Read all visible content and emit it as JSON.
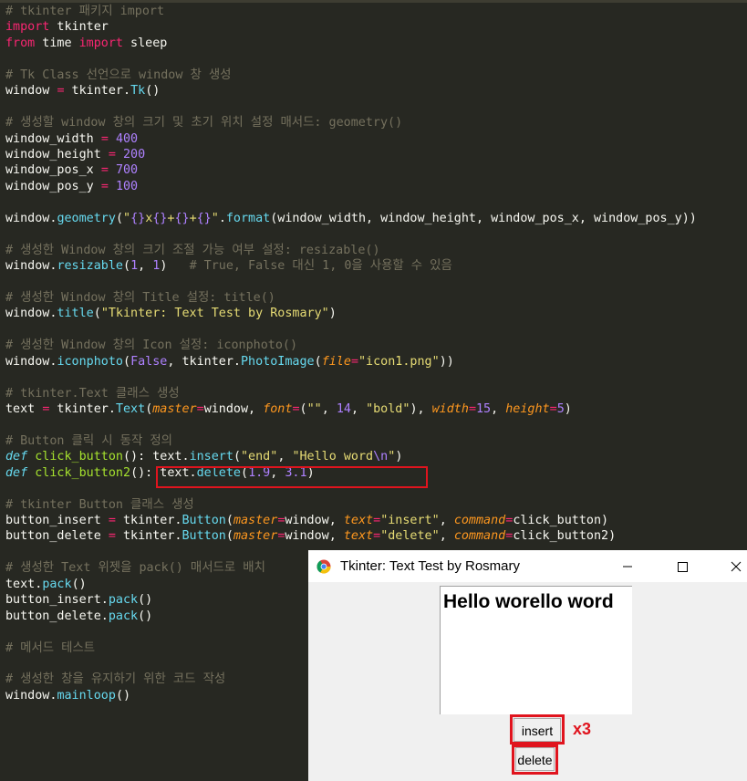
{
  "editor": {
    "lines": [
      [
        {
          "t": "# tkinter 패키지 import",
          "c": "c"
        }
      ],
      [
        {
          "t": "import",
          "c": "k"
        },
        {
          "t": " tkinter"
        }
      ],
      [
        {
          "t": "from",
          "c": "k"
        },
        {
          "t": " time "
        },
        {
          "t": "import",
          "c": "k"
        },
        {
          "t": " sleep"
        }
      ],
      [],
      [
        {
          "t": "# Tk Class 선언으로 window 창 생성",
          "c": "c"
        }
      ],
      [
        {
          "t": "window "
        },
        {
          "t": "=",
          "c": "o"
        },
        {
          "t": " tkinter."
        },
        {
          "t": "Tk",
          "c": "f"
        },
        {
          "t": "()"
        }
      ],
      [],
      [
        {
          "t": "# 생성할 window 창의 크기 및 초기 위치 설정 매서드: geometry()",
          "c": "c"
        }
      ],
      [
        {
          "t": "window_width "
        },
        {
          "t": "=",
          "c": "o"
        },
        {
          "t": " "
        },
        {
          "t": "400",
          "c": "n"
        }
      ],
      [
        {
          "t": "window_height "
        },
        {
          "t": "=",
          "c": "o"
        },
        {
          "t": " "
        },
        {
          "t": "200",
          "c": "n"
        }
      ],
      [
        {
          "t": "window_pos_x "
        },
        {
          "t": "=",
          "c": "o"
        },
        {
          "t": " "
        },
        {
          "t": "700",
          "c": "n"
        }
      ],
      [
        {
          "t": "window_pos_y "
        },
        {
          "t": "=",
          "c": "o"
        },
        {
          "t": " "
        },
        {
          "t": "100",
          "c": "n"
        }
      ],
      [],
      [
        {
          "t": "window."
        },
        {
          "t": "geometry",
          "c": "f"
        },
        {
          "t": "("
        },
        {
          "t": "\"",
          "c": "s"
        },
        {
          "t": "{}",
          "c": "e"
        },
        {
          "t": "x",
          "c": "s"
        },
        {
          "t": "{}",
          "c": "e"
        },
        {
          "t": "+",
          "c": "s"
        },
        {
          "t": "{}",
          "c": "e"
        },
        {
          "t": "+",
          "c": "s"
        },
        {
          "t": "{}",
          "c": "e"
        },
        {
          "t": "\"",
          "c": "s"
        },
        {
          "t": "."
        },
        {
          "t": "format",
          "c": "f"
        },
        {
          "t": "(window_width, window_height, window_pos_x, window_pos_y))"
        }
      ],
      [],
      [
        {
          "t": "# 생성한 Window 창의 크기 조절 가능 여부 설정: resizable()",
          "c": "c"
        }
      ],
      [
        {
          "t": "window."
        },
        {
          "t": "resizable",
          "c": "f"
        },
        {
          "t": "("
        },
        {
          "t": "1",
          "c": "n"
        },
        {
          "t": ", "
        },
        {
          "t": "1",
          "c": "n"
        },
        {
          "t": ")   "
        },
        {
          "t": "# True, False 대신 1, 0을 사용할 수 있음",
          "c": "c"
        }
      ],
      [],
      [
        {
          "t": "# 생성한 Window 창의 Title 설정: title()",
          "c": "c"
        }
      ],
      [
        {
          "t": "window."
        },
        {
          "t": "title",
          "c": "f"
        },
        {
          "t": "("
        },
        {
          "t": "\"Tkinter: Text Test by Rosmary\"",
          "c": "s"
        },
        {
          "t": ")"
        }
      ],
      [],
      [
        {
          "t": "# 생성한 Window 창의 Icon 설정: iconphoto()",
          "c": "c"
        }
      ],
      [
        {
          "t": "window."
        },
        {
          "t": "iconphoto",
          "c": "f"
        },
        {
          "t": "("
        },
        {
          "t": "False",
          "c": "n"
        },
        {
          "t": ", tkinter."
        },
        {
          "t": "PhotoImage",
          "c": "f"
        },
        {
          "t": "("
        },
        {
          "t": "file",
          "c": "a"
        },
        {
          "t": "=",
          "c": "o"
        },
        {
          "t": "\"icon1.png\"",
          "c": "s"
        },
        {
          "t": "))"
        }
      ],
      [],
      [
        {
          "t": "# tkinter.Text 클래스 생성",
          "c": "c"
        }
      ],
      [
        {
          "t": "text "
        },
        {
          "t": "=",
          "c": "o"
        },
        {
          "t": " tkinter."
        },
        {
          "t": "Text",
          "c": "f"
        },
        {
          "t": "("
        },
        {
          "t": "master",
          "c": "a"
        },
        {
          "t": "=",
          "c": "o"
        },
        {
          "t": "window, "
        },
        {
          "t": "font",
          "c": "a"
        },
        {
          "t": "=",
          "c": "o"
        },
        {
          "t": "("
        },
        {
          "t": "\"\"",
          "c": "s"
        },
        {
          "t": ", "
        },
        {
          "t": "14",
          "c": "n"
        },
        {
          "t": ", "
        },
        {
          "t": "\"bold\"",
          "c": "s"
        },
        {
          "t": "), "
        },
        {
          "t": "width",
          "c": "a"
        },
        {
          "t": "=",
          "c": "o"
        },
        {
          "t": "15",
          "c": "n"
        },
        {
          "t": ", "
        },
        {
          "t": "height",
          "c": "a"
        },
        {
          "t": "=",
          "c": "o"
        },
        {
          "t": "5",
          "c": "n"
        },
        {
          "t": ")"
        }
      ],
      [],
      [
        {
          "t": "# Button 클릭 시 동작 정의",
          "c": "c"
        }
      ],
      [
        {
          "t": "def",
          "c": "d"
        },
        {
          "t": " "
        },
        {
          "t": "click_button",
          "c": "g"
        },
        {
          "t": "(): text."
        },
        {
          "t": "insert",
          "c": "f"
        },
        {
          "t": "("
        },
        {
          "t": "\"end\"",
          "c": "s"
        },
        {
          "t": ", "
        },
        {
          "t": "\"Hello word",
          "c": "s"
        },
        {
          "t": "\\n",
          "c": "e"
        },
        {
          "t": "\"",
          "c": "s"
        },
        {
          "t": ")"
        }
      ],
      [
        {
          "t": "def",
          "c": "d"
        },
        {
          "t": " "
        },
        {
          "t": "click_button2",
          "c": "g"
        },
        {
          "t": "(): text."
        },
        {
          "t": "delete",
          "c": "f"
        },
        {
          "t": "("
        },
        {
          "t": "1.9",
          "c": "n"
        },
        {
          "t": ", "
        },
        {
          "t": "3.1",
          "c": "n"
        },
        {
          "t": ")"
        }
      ],
      [],
      [
        {
          "t": "# tkinter Button 클래스 생성",
          "c": "c"
        }
      ],
      [
        {
          "t": "button_insert "
        },
        {
          "t": "=",
          "c": "o"
        },
        {
          "t": " tkinter."
        },
        {
          "t": "Button",
          "c": "f"
        },
        {
          "t": "("
        },
        {
          "t": "master",
          "c": "a"
        },
        {
          "t": "=",
          "c": "o"
        },
        {
          "t": "window, "
        },
        {
          "t": "text",
          "c": "a"
        },
        {
          "t": "=",
          "c": "o"
        },
        {
          "t": "\"insert\"",
          "c": "s"
        },
        {
          "t": ", "
        },
        {
          "t": "command",
          "c": "a"
        },
        {
          "t": "=",
          "c": "o"
        },
        {
          "t": "click_button)"
        }
      ],
      [
        {
          "t": "button_delete "
        },
        {
          "t": "=",
          "c": "o"
        },
        {
          "t": " tkinter."
        },
        {
          "t": "Button",
          "c": "f"
        },
        {
          "t": "("
        },
        {
          "t": "master",
          "c": "a"
        },
        {
          "t": "=",
          "c": "o"
        },
        {
          "t": "window, "
        },
        {
          "t": "text",
          "c": "a"
        },
        {
          "t": "=",
          "c": "o"
        },
        {
          "t": "\"delete\"",
          "c": "s"
        },
        {
          "t": ", "
        },
        {
          "t": "command",
          "c": "a"
        },
        {
          "t": "=",
          "c": "o"
        },
        {
          "t": "click_button2)"
        }
      ],
      [],
      [
        {
          "t": "# 생성한 Text 위젯을 pack() 매서드로 배치",
          "c": "c"
        }
      ],
      [
        {
          "t": "text."
        },
        {
          "t": "pack",
          "c": "f"
        },
        {
          "t": "()"
        }
      ],
      [
        {
          "t": "button_insert."
        },
        {
          "t": "pack",
          "c": "f"
        },
        {
          "t": "()"
        }
      ],
      [
        {
          "t": "button_delete."
        },
        {
          "t": "pack",
          "c": "f"
        },
        {
          "t": "()"
        }
      ],
      [],
      [
        {
          "t": "# 메서드 테스트",
          "c": "c"
        }
      ],
      [],
      [
        {
          "t": "# 생성한 창을 유지하기 위한 코드 작성",
          "c": "c"
        }
      ],
      [
        {
          "t": "window."
        },
        {
          "t": "mainloop",
          "c": "f"
        },
        {
          "t": "()"
        }
      ]
    ]
  },
  "tk_window": {
    "title": "Tkinter: Text Test by Rosmary",
    "icon": "chrome-like-icon",
    "text_content": "Hello worello word",
    "insert_label": "insert",
    "delete_label": "delete",
    "annotation": "x3"
  },
  "colors": {
    "editor_bg": "#272822",
    "highlight_red": "#e0141e"
  }
}
